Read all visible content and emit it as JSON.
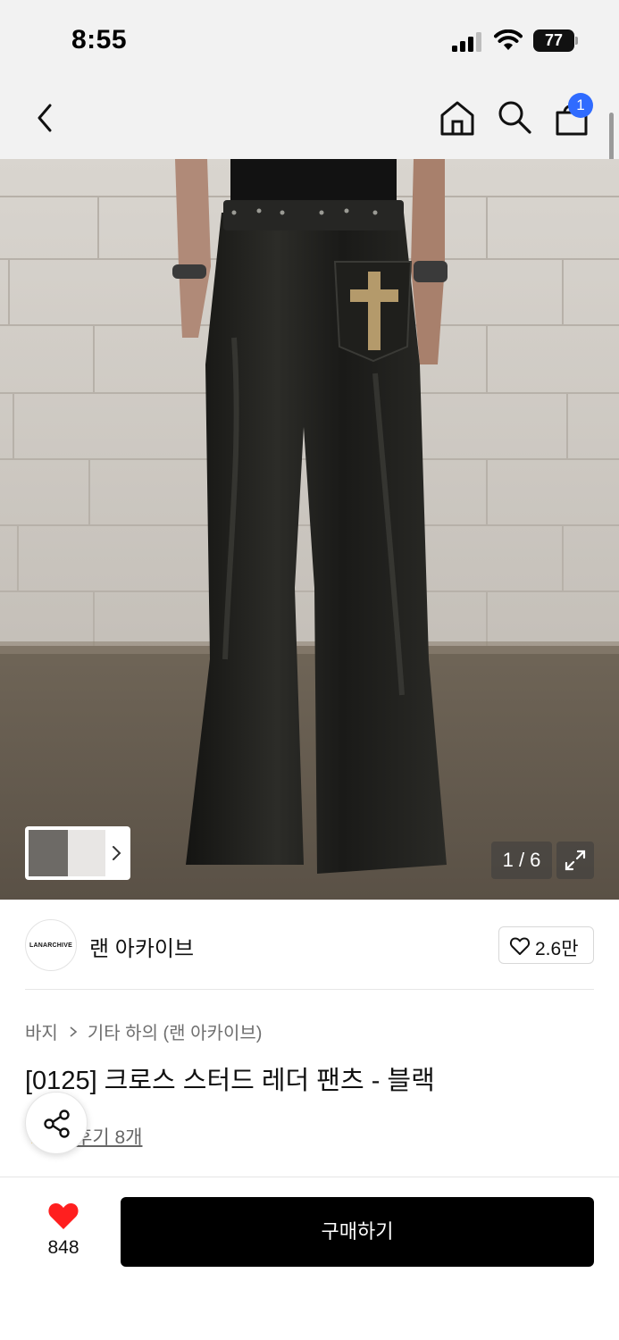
{
  "status_bar": {
    "time": "8:55",
    "battery": "77"
  },
  "nav": {
    "cart_badge": "1",
    "icons": [
      "back-chevron-icon",
      "home-icon",
      "search-icon",
      "shopping-bag-icon"
    ]
  },
  "gallery": {
    "counter": "1 / 6",
    "image_subject": "black leather flared pants with studded cross pocket"
  },
  "brand": {
    "logo_text": "LANARCHIVE",
    "name": "랜 아카이브",
    "likes": "2.6만"
  },
  "product": {
    "breadcrumb": [
      "바지",
      "기타 하의 (랜 아카이브)"
    ],
    "title": "[0125] 크로스 스터드 레더 팬츠 - 블랙",
    "review_link": "후기 8개"
  },
  "bottom_bar": {
    "like_count": "848",
    "buy_label": "구매하기"
  },
  "colors": {
    "badge": "#2f6bff",
    "heart": "#ff1f1f",
    "buy_button": "#000000"
  }
}
